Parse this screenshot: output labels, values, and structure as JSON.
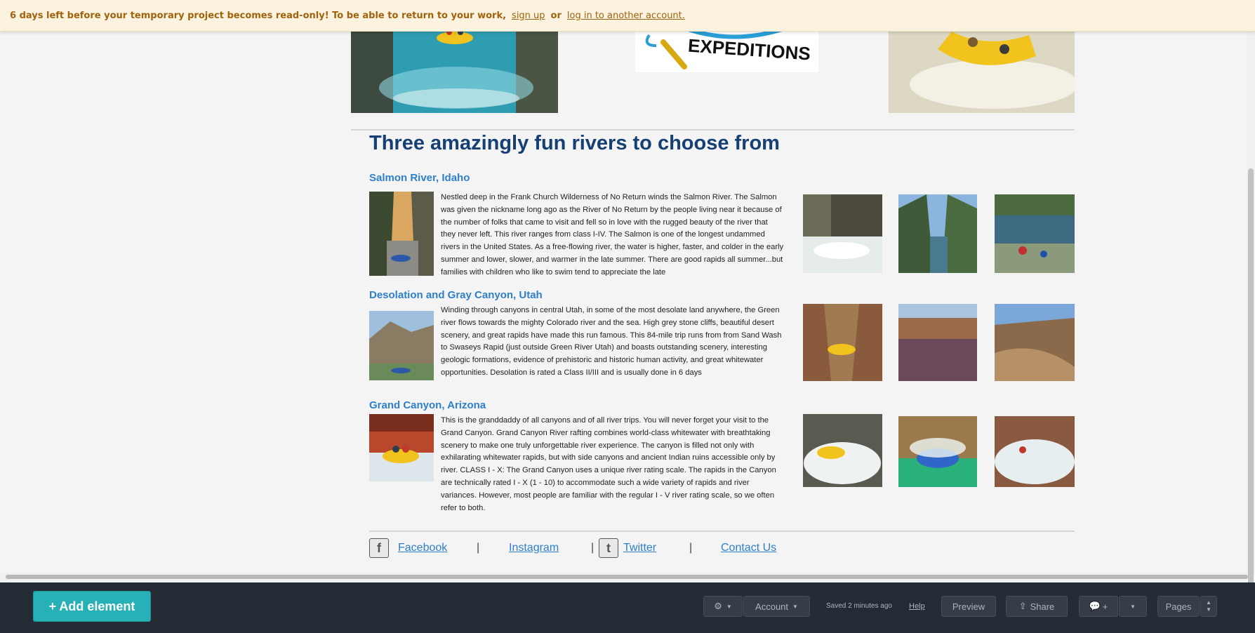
{
  "banner": {
    "message": "6 days left before your temporary project becomes read-only! To be able to return to your work,",
    "signup": "sign up",
    "or": "or",
    "login": "log in to another account."
  },
  "header_images": {
    "logo_text": "EXPEDITIONS"
  },
  "main": {
    "heading": "Three amazingly fun rivers to choose from",
    "rivers": [
      {
        "name": "Salmon River, Idaho",
        "description": "Nestled deep in the Frank Church Wilderness of No Return winds the Salmon River. The Salmon was given the nickname long ago as the River of No Return by the people living near it because of the number of folks that came to visit and fell so in love with the rugged beauty of the river that they never left. This river ranges from class I-IV. The Salmon is one of the longest undammed rivers in the United States. As a free-flowing river, the water is higher, faster, and colder in the early summer and lower, slower, and warmer in the late summer. There are good rapids all summer...but families with children who like to swim tend to appreciate the late"
      },
      {
        "name": "Desolation and Gray Canyon, Utah",
        "description": "Winding through canyons in central Utah, in some of the most desolate land anywhere, the Green river flows towards the mighty Colorado river and the sea. High grey stone cliffs, beautiful desert scenery, and great rapids have made this run famous. This 84-mile trip runs from from Sand Wash to Swaseys Rapid (just outside Green River Utah) and boasts outstanding scenery, interesting geologic formations, evidence of prehistoric and historic human activity, and great whitewater opportunities. Desolation is rated a Class II/III and is usually done in 6 days"
      },
      {
        "name": "Grand Canyon, Arizona",
        "description": "This is the granddaddy of all canyons and of all river trips. You will never forget your visit to the Grand Canyon. Grand Canyon River rafting combines world-class whitewater with breathtaking scenery to make one truly unforgettable river experience. The canyon is filled not only with exhilarating whitewater rapids, but with side canyons and ancient Indian ruins accessible only by river. CLASS I - X: The Grand Canyon uses a unique river rating scale. The rapids in the Canyon are technically rated I - X (1 - 10) to accommodate such a wide variety of rapids and river variances. However, most people are familiar with the regular I - V river rating scale, so we often refer to both."
      }
    ]
  },
  "footer": {
    "facebook": "Facebook",
    "instagram": "Instagram",
    "twitter": "Twitter",
    "contact": "Contact Us",
    "separator": "|"
  },
  "toolbar": {
    "add_element": "+ Add element",
    "account": "Account",
    "saved_status": "Saved 2 minutes ago",
    "help": "Help",
    "preview": "Preview",
    "share": "Share",
    "comment_plus": "+",
    "pages": "Pages"
  }
}
